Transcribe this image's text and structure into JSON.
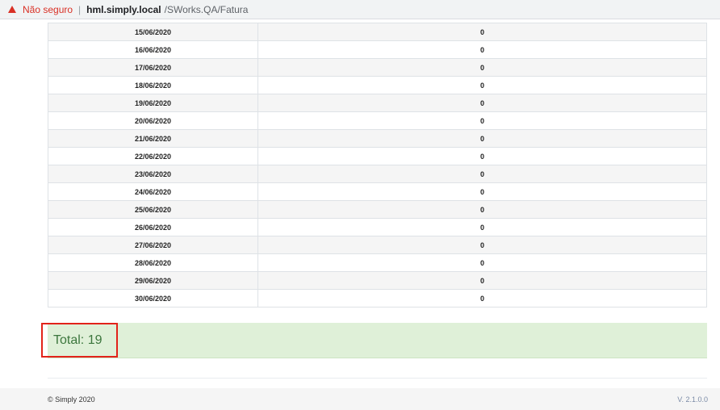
{
  "browser": {
    "insecure_label": "Não seguro",
    "separator": "|",
    "host": "hml.simply.local",
    "path": "/SWorks.QA/Fatura"
  },
  "table": {
    "rows": [
      {
        "date": "15/06/2020",
        "value": "0"
      },
      {
        "date": "16/06/2020",
        "value": "0"
      },
      {
        "date": "17/06/2020",
        "value": "0"
      },
      {
        "date": "18/06/2020",
        "value": "0"
      },
      {
        "date": "19/06/2020",
        "value": "0"
      },
      {
        "date": "20/06/2020",
        "value": "0"
      },
      {
        "date": "21/06/2020",
        "value": "0"
      },
      {
        "date": "22/06/2020",
        "value": "0"
      },
      {
        "date": "23/06/2020",
        "value": "0"
      },
      {
        "date": "24/06/2020",
        "value": "0"
      },
      {
        "date": "25/06/2020",
        "value": "0"
      },
      {
        "date": "26/06/2020",
        "value": "0"
      },
      {
        "date": "27/06/2020",
        "value": "0"
      },
      {
        "date": "28/06/2020",
        "value": "0"
      },
      {
        "date": "29/06/2020",
        "value": "0"
      },
      {
        "date": "30/06/2020",
        "value": "0"
      }
    ]
  },
  "summary": {
    "total_label": "Total: 19"
  },
  "footer": {
    "copyright": "© Simply 2020",
    "version": "V. 2.1.0.0"
  },
  "colors": {
    "highlight_border": "#e2231a",
    "total_background": "#dff0d8",
    "total_text": "#3c763d"
  }
}
